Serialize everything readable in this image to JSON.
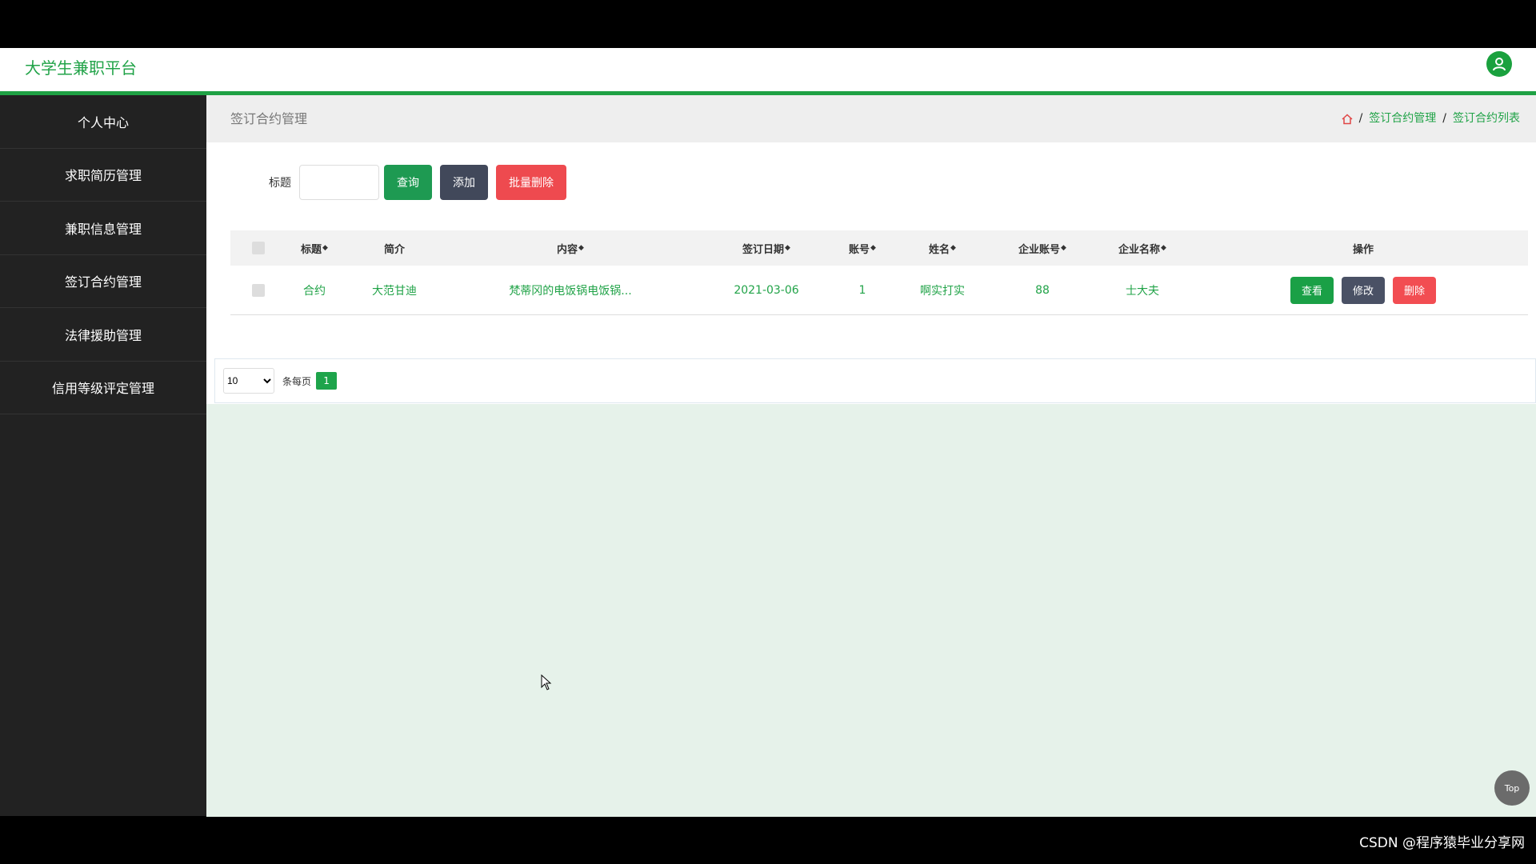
{
  "header": {
    "title": "大学生兼职平台"
  },
  "sidebar": {
    "items": [
      {
        "label": "个人中心"
      },
      {
        "label": "求职简历管理"
      },
      {
        "label": "兼职信息管理"
      },
      {
        "label": "签订合约管理"
      },
      {
        "label": "法律援助管理"
      },
      {
        "label": "信用等级评定管理"
      }
    ]
  },
  "page": {
    "title": "签订合约管理",
    "breadcrumb": [
      "签订合约管理",
      "签订合约列表"
    ]
  },
  "search": {
    "label": "标题",
    "value": "",
    "query_label": "查询",
    "add_label": "添加",
    "batch_delete_label": "批量删除"
  },
  "table": {
    "headers": [
      {
        "label": "标题",
        "sortable": true
      },
      {
        "label": "简介",
        "sortable": false
      },
      {
        "label": "内容",
        "sortable": true
      },
      {
        "label": "签订日期",
        "sortable": true
      },
      {
        "label": "账号",
        "sortable": true
      },
      {
        "label": "姓名",
        "sortable": true
      },
      {
        "label": "企业账号",
        "sortable": true
      },
      {
        "label": "企业名称",
        "sortable": true
      },
      {
        "label": "操作",
        "sortable": false
      }
    ],
    "rows": [
      {
        "title": "合约",
        "intro": "大范甘迪",
        "content": "梵蒂冈的电饭锅电饭锅...",
        "date": "2021-03-06",
        "account": "1",
        "name": "啊实打实",
        "company_account": "88",
        "company_name": "士大夫",
        "view_label": "查看",
        "edit_label": "修改",
        "delete_label": "删除"
      }
    ]
  },
  "pagination": {
    "page_size": "10",
    "per_page_label": "条每页",
    "current_page": "1"
  },
  "top_button": {
    "label": "Top"
  },
  "watermark": {
    "text": "CSDN @程序猿毕业分享网"
  },
  "colors": {
    "brand": "#1fa144",
    "danger": "#f24d52",
    "sidebar": "#222222"
  }
}
